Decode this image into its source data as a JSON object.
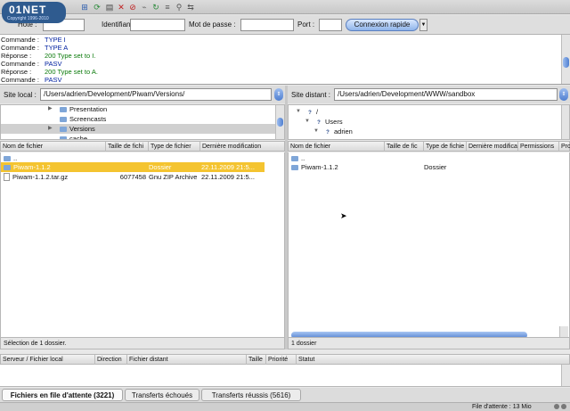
{
  "watermark": {
    "brand": "01NET",
    "tagline": "Copyright 1996-2010"
  },
  "quickconnect": {
    "host_label": "Hôte :",
    "user_label": "Identifiant :",
    "password_label": "Mot de passe :",
    "port_label": "Port :",
    "connect_button": "Connexion rapide",
    "host_value": "",
    "user_value": "",
    "password_value": "",
    "port_value": ""
  },
  "log": [
    {
      "label": "Commande :",
      "text": "TYPE I",
      "kind": "command"
    },
    {
      "label": "Commande :",
      "text": "TYPE A",
      "kind": "command"
    },
    {
      "label": "Réponse :",
      "text": "200 Type set to I.",
      "kind": "response"
    },
    {
      "label": "Commande :",
      "text": "PASV",
      "kind": "command"
    },
    {
      "label": "Réponse :",
      "text": "200 Type set to A.",
      "kind": "response"
    },
    {
      "label": "Commande :",
      "text": "PASV",
      "kind": "command"
    }
  ],
  "local": {
    "site_label": "Site local :",
    "path": "/Users/adrien/Development/Piwam/Versions/",
    "tree": [
      {
        "name": "Presentation"
      },
      {
        "name": "Screencasts"
      },
      {
        "name": "Versions"
      },
      {
        "name": "cache"
      }
    ],
    "columns": [
      "Nom de fichier",
      "Taille de fichi",
      "Type de fichier",
      "Dernière modification"
    ],
    "files": [
      {
        "name": "..",
        "size": "",
        "type": "",
        "modified": ""
      },
      {
        "name": "Piwam-1.1.2",
        "size": "",
        "type": "Dossier",
        "modified": "22.11.2009 21:5..."
      },
      {
        "name": "Piwam-1.1.2.tar.gz",
        "size": "6077458",
        "type": "Gnu ZIP Archive",
        "modified": "22.11.2009 21:5..."
      }
    ],
    "status": "Sélection de 1 dossier."
  },
  "remote": {
    "site_label": "Site distant :",
    "path": "/Users/adrien/Development/WWW/sandbox",
    "tree": [
      {
        "name": "/"
      },
      {
        "name": "Users"
      },
      {
        "name": "adrien"
      }
    ],
    "columns": [
      "Nom de fichier",
      "Taille de fic",
      "Type de fichie",
      "Dernière modifica",
      "Permissions",
      "Pro"
    ],
    "files": [
      {
        "name": "..",
        "type": ""
      },
      {
        "name": "Piwam-1.1.2",
        "type": "Dossier"
      }
    ],
    "status": "1 dossier"
  },
  "queue": {
    "columns": [
      "Serveur / Fichier local",
      "Direction",
      "Fichier distant",
      "Taille",
      "Priorité",
      "Statut"
    ]
  },
  "tabs": [
    {
      "label": "Fichiers en file d'attente (3221)"
    },
    {
      "label": "Transferts échoués"
    },
    {
      "label": "Transferts réussis (5616)"
    }
  ],
  "bottom": {
    "queue_status": "File d'attente : 13 Mio"
  }
}
